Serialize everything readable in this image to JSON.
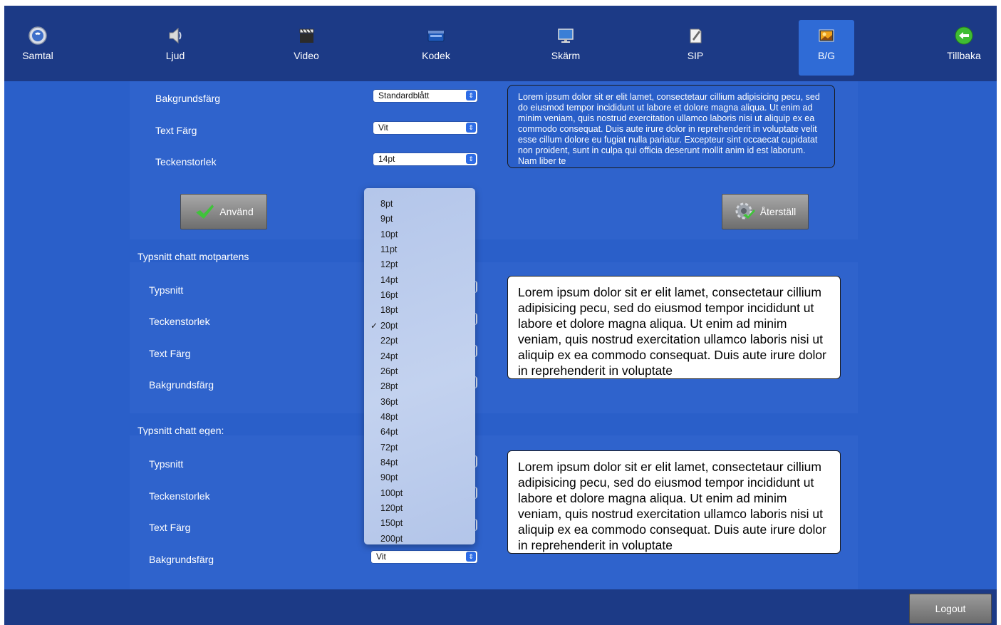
{
  "toolbar": {
    "items": [
      {
        "label": "Samtal",
        "icon": "phone-globe-icon"
      },
      {
        "label": "Ljud",
        "icon": "speaker-icon"
      },
      {
        "label": "Video",
        "icon": "clapperboard-icon"
      },
      {
        "label": "Kodek",
        "icon": "codec-icon"
      },
      {
        "label": "Skärm",
        "icon": "monitor-icon"
      },
      {
        "label": "SIP",
        "icon": "sip-document-icon"
      },
      {
        "label": "B/G",
        "icon": "image-icon",
        "active": true
      },
      {
        "label": "Tillbaka",
        "icon": "back-arrow-icon"
      }
    ]
  },
  "general": {
    "background_label": "Bakgrundsfärg",
    "background_value": "Standardblått",
    "text_color_label": "Text Färg",
    "text_color_value": "Vit",
    "font_size_label": "Teckenstorlek",
    "font_size_value": "14pt",
    "apply_button": "Använd",
    "reset_button": "Återställ",
    "preview_text": "Lorem ipsum dolor sit er elit lamet, consectetaur cillium adipisicing pecu, sed do eiusmod tempor incididunt ut labore et dolore magna aliqua. Ut enim ad minim veniam, quis nostrud exercitation ullamco laboris nisi ut aliquip ex ea commodo consequat. Duis aute irure dolor in reprehenderit in voluptate velit esse cillum dolore eu fugiat nulla pariatur. Excepteur sint occaecat cupidatat non proident, sunt in culpa qui officia deserunt mollit anim id est laborum. Nam liber te"
  },
  "chat_peer": {
    "title": "Typsnitt chatt motpartens",
    "font_label": "Typsnitt",
    "size_label": "Teckenstorlek",
    "color_label": "Text Färg",
    "background_label": "Bakgrundsfärg",
    "preview_text": "Lorem ipsum dolor sit er elit lamet, consectetaur cillium adipisicing pecu, sed do eiusmod tempor incididunt ut labore et dolore magna aliqua. Ut enim ad minim veniam, quis nostrud exercitation ullamco laboris nisi ut aliquip ex ea commodo consequat. Duis aute irure dolor in reprehenderit in voluptate"
  },
  "chat_own": {
    "title": "Typsnitt chatt egen:",
    "font_label": "Typsnitt",
    "size_label": "Teckenstorlek",
    "color_label": "Text Färg",
    "background_label": "Bakgrundsfärg",
    "background_value": "Vit",
    "preview_text": "Lorem ipsum dolor sit er elit lamet, consectetaur cillium adipisicing pecu, sed do eiusmod tempor incididunt ut labore et dolore magna aliqua. Ut enim ad minim veniam, quis nostrud exercitation ullamco laboris nisi ut aliquip ex ea commodo consequat. Duis aute irure dolor in reprehenderit in voluptate"
  },
  "dropdown": {
    "options": [
      "8pt",
      "9pt",
      "10pt",
      "11pt",
      "12pt",
      "14pt",
      "16pt",
      "18pt",
      "20pt",
      "22pt",
      "24pt",
      "26pt",
      "28pt",
      "36pt",
      "48pt",
      "64pt",
      "72pt",
      "84pt",
      "90pt",
      "100pt",
      "120pt",
      "150pt",
      "200pt"
    ],
    "selected": "20pt",
    "check_mark": "✓"
  },
  "footer": {
    "logout_label": "Logout"
  }
}
